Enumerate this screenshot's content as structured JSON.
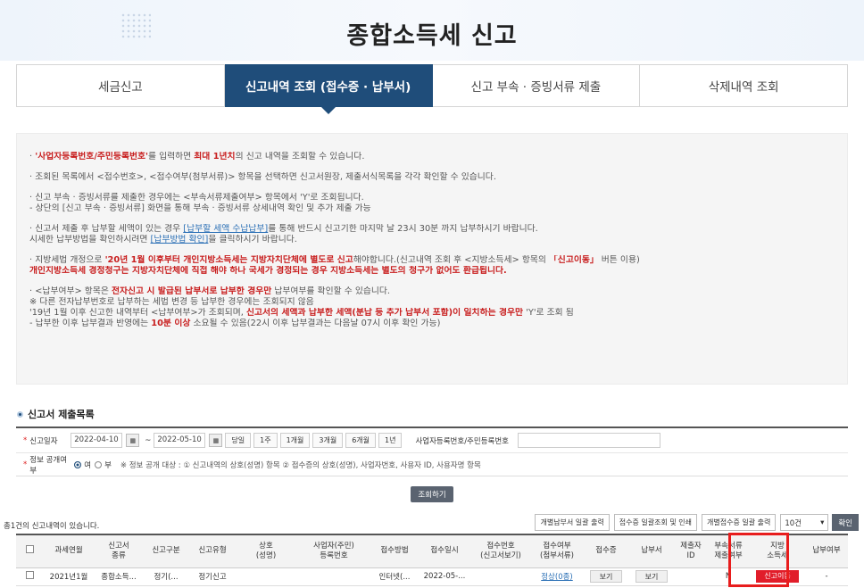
{
  "page": {
    "title": "종합소득세 신고"
  },
  "tabs": [
    {
      "label": "세금신고",
      "active": false
    },
    {
      "label": "신고내역 조회 (접수증 · 납부서)",
      "active": true
    },
    {
      "label": "신고 부속 · 증빙서류 제출",
      "active": false
    },
    {
      "label": "삭제내역 조회",
      "active": false
    }
  ],
  "notice": {
    "l1_bullet": "· ",
    "l1_red": "'사업자등록번호/주민등록번호'",
    "l1_mid": "를 입력하면 ",
    "l1_red2": "최대 1년치",
    "l1_end": "의 신고 내역을 조회할 수 있습니다.",
    "l2": "· 조회된 목록에서 <접수번호>, <접수여부(첨부서류)> 항목을 선택하면 신고서원장, 제출서식목록을 각각 확인할 수 있습니다.",
    "l3": "· 신고 부속 · 증빙서류를 제출한 경우에는 <부속서류제출여부> 항목에서 'Y'로 조회됩니다.",
    "l4": "  - 상단의 [신고 부속 · 증빙서류] 화면을 통해 부속 · 증빙서류 상세내역 확인 및 추가 제출 가능",
    "l5_a": "· 신고서 제출 후 납부할 세액이 있는 경우 ",
    "l5_link": "[납부할 세액 수납납부]",
    "l5_b": "를 통해 반드시 신고기한 마지막 날 23시 30분 까지 납부하시기 바랍니다.",
    "l6_a": "  시세한 납부방법을 확인하시려면 ",
    "l6_link": "[납부방법 확인]",
    "l6_b": "을 클릭하시기 바랍니다.",
    "l7_a": "· 지방세법 개정으로 ",
    "l7_red": "'20년 1월 이후부터 개인지방소득세는 지방자치단체에 별도로 신고",
    "l7_b": "해야합니다.(신고내역 조회 후 <지방소득세> 항목의 ",
    "l7_red2": "「신고이동」",
    "l7_c": " 버튼 이용)",
    "l8_red": "개인지방소득세 경정청구는 지방자치단체에 직접 해야 하나 국세가 경정되는 경우 지방소득세는 별도의 청구가 없어도 환급됩니다.",
    "l9_a": "· <납부여부> 항목은 ",
    "l9_red": "전자신고 시 발급된 납부서로 납부한 경우만",
    "l9_b": " 납부여부를 확인할 수 있습니다.",
    "l10": "  ※ 다른 전자납부번호로 납부하는 세법 변경 등 납부한 경우에는 조회되지 않음",
    "l11_a": "  '19년 1월 이후 신고한 내역부터 <납부여부>가 조회되며, ",
    "l11_red": "신고서의 세액과 납부한 세액(분납 등 추가 납부서 포함)이 일치하는 경우만",
    "l11_b": " 'Y'로 조회 됨",
    "l12_a": "  - 납부한 이후 납부결과 반영에는 ",
    "l12_red": "10분 이상",
    "l12_b": " 소요될 수 있음(22시 이후 납부결과는 다음날 07시 이후 확인 가능)"
  },
  "section": {
    "title": "신고서 제출목록"
  },
  "filter": {
    "date_label": "신고일자",
    "date_from": "2022-04-10",
    "date_to": "2022-05-10",
    "periods": [
      "당일",
      "1주",
      "1개월",
      "3개월",
      "6개월",
      "1년"
    ],
    "id_label": "사업자등록번호/주민등록번호",
    "public_label": "정보 공개여부",
    "radio_yes": "여",
    "radio_no": "부",
    "public_note": "※ 정보 공개 대상 : ① 신고내역의 상호(성명) 항목 ② 접수증의 상호(성명), 사업자번호, 사용자 ID, 사용자명 항목",
    "search_btn": "조회하기"
  },
  "results": {
    "count_text": "총1건의 신고내역이 있습니다.",
    "btn_bulk_pay": "개별납부서 일괄 출력",
    "btn_bulk_receipt": "접수증 일괄조회 및 인쇄",
    "btn_bulk_detail": "개별접수증 일괄 출력",
    "page_size": "10건",
    "btn_confirm": "확인"
  },
  "table": {
    "headers": [
      "",
      "과세연월",
      "신고서\n종류",
      "신고구분",
      "신고유형",
      "상호\n(성명)",
      "사업자(주민)\n등록번호",
      "접수방법",
      "접수일시",
      "접수번호\n(신고서보기)",
      "접수여부\n(첨부서류)",
      "접수증",
      "납부서",
      "제출자\nID",
      "부속서류\n제출여부",
      "지방\n소득세",
      "납부여부"
    ],
    "rows": [
      {
        "period": "2021년1월",
        "type": "종합소득...",
        "gubun": "정기(...",
        "kind": "정기신고",
        "name": "",
        "regno": "",
        "method": "인터넷(...",
        "datetime": "2022-05-...",
        "receipt_no": "",
        "status": "정상(0종)",
        "receipt_btn": "보기",
        "bill_btn": "보기",
        "submitter": "",
        "attach": "N",
        "local_tax_btn": "신고이동",
        "paid": "-"
      }
    ]
  },
  "colors": {
    "navy": "#1f4d7a",
    "red": "#e11d2a",
    "highlight": "#e81d1d"
  }
}
